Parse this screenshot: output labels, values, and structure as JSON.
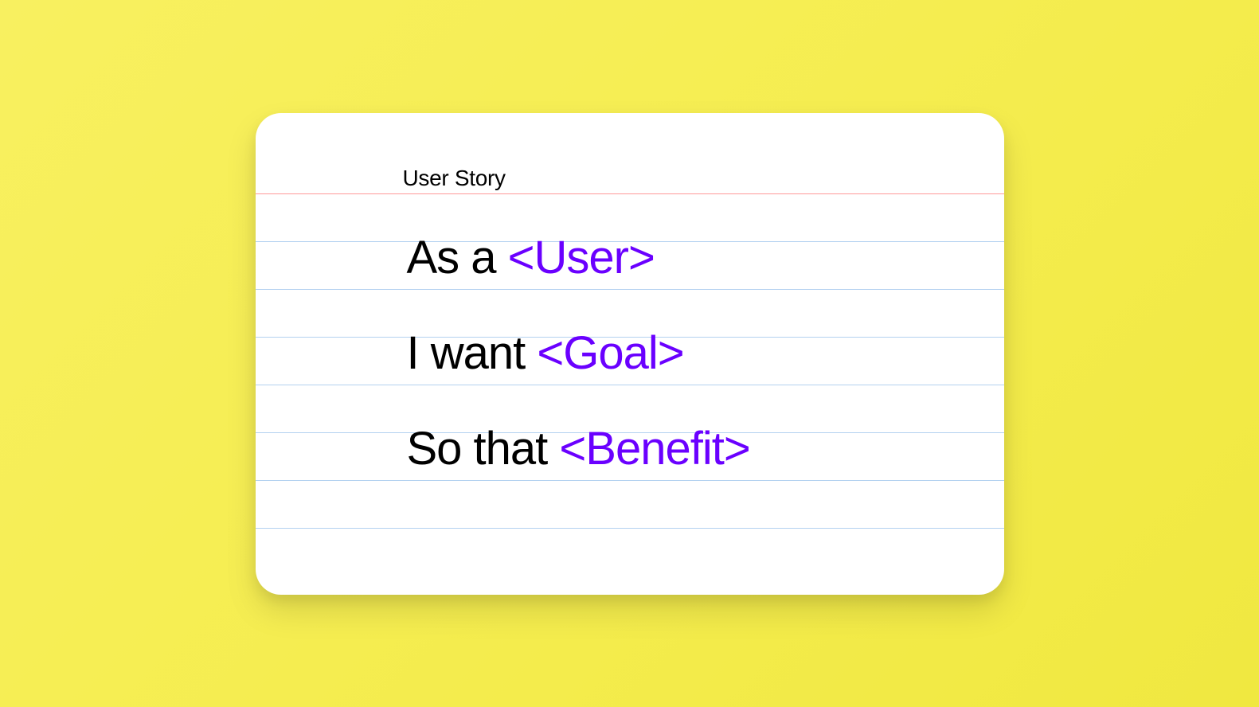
{
  "card": {
    "title": "User Story",
    "lines": [
      {
        "prefix": "As a ",
        "placeholder": "<User>"
      },
      {
        "prefix": "I want  ",
        "placeholder": "<Goal>"
      },
      {
        "prefix": "So that  ",
        "placeholder": "<Benefit>"
      }
    ]
  },
  "colors": {
    "background": "#f5ed50",
    "card": "#ffffff",
    "redLine": "#ff9999",
    "blueLine": "#b3d1f0",
    "text": "#000000",
    "placeholder": "#6a00ff"
  }
}
